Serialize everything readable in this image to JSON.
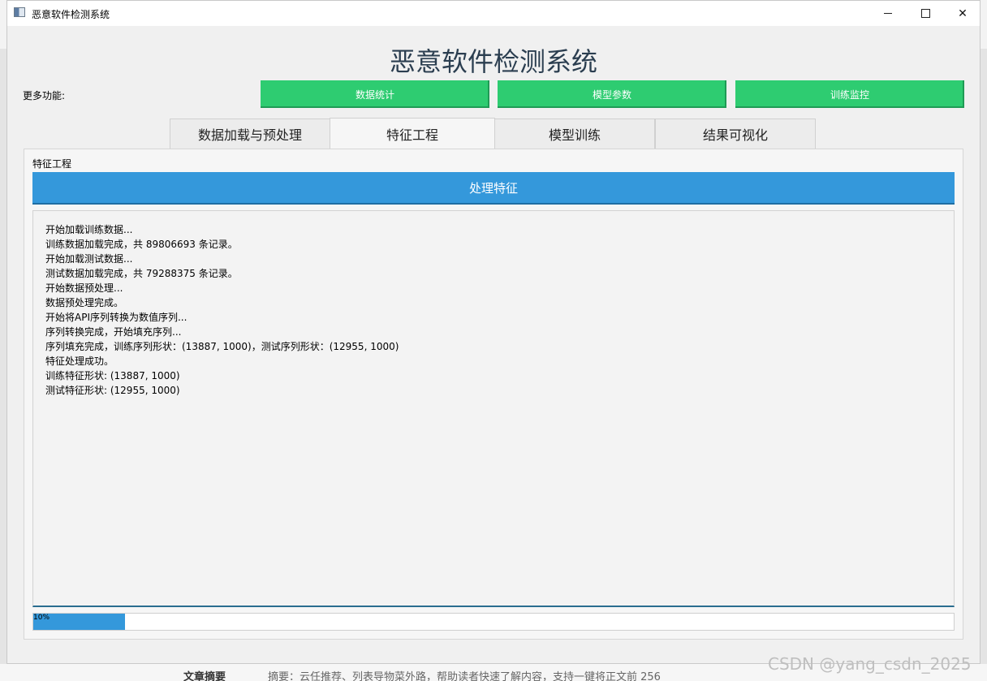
{
  "window": {
    "title": "恶意软件检测系统",
    "controls": {
      "minimize": "minimize-icon",
      "maximize": "maximize-icon",
      "close": "close-icon"
    }
  },
  "header": {
    "main_title": "恶意软件检测系统",
    "more_label": "更多功能:",
    "buttons": [
      "数据统计",
      "模型参数",
      "训练监控"
    ]
  },
  "tabs": [
    {
      "label": "数据加载与预处理",
      "active": false
    },
    {
      "label": "特征工程",
      "active": true
    },
    {
      "label": "模型训练",
      "active": false
    },
    {
      "label": "结果可视化",
      "active": false
    }
  ],
  "panel": {
    "group_label": "特征工程",
    "process_button": "处理特征",
    "log_lines": [
      "开始加载训练数据...",
      "训练数据加载完成，共 89806693 条记录。",
      "开始加载测试数据...",
      "测试数据加载完成，共 79288375 条记录。",
      "开始数据预处理...",
      "数据预处理完成。",
      "开始将API序列转换为数值序列...",
      "序列转换完成，开始填充序列...",
      "序列填充完成，训练序列形状：(13887, 1000)，测试序列形状：(12955, 1000)",
      "特征处理成功。",
      "训练特征形状: (13887, 1000)",
      "测试特征形状: (12955, 1000)"
    ],
    "progress": {
      "text": "10%",
      "value": 0.1
    }
  },
  "colors": {
    "accent_green": "#2ecc71",
    "accent_blue": "#3498db",
    "title_color": "#2b3e50"
  },
  "background": {
    "summary_label": "文章摘要",
    "summary_text": "摘要：云任推荐、列表导物菜外路，帮助读者快速了解内容，支持一键将正文前 256",
    "watermark": "CSDN @yang_csdn_2025"
  }
}
